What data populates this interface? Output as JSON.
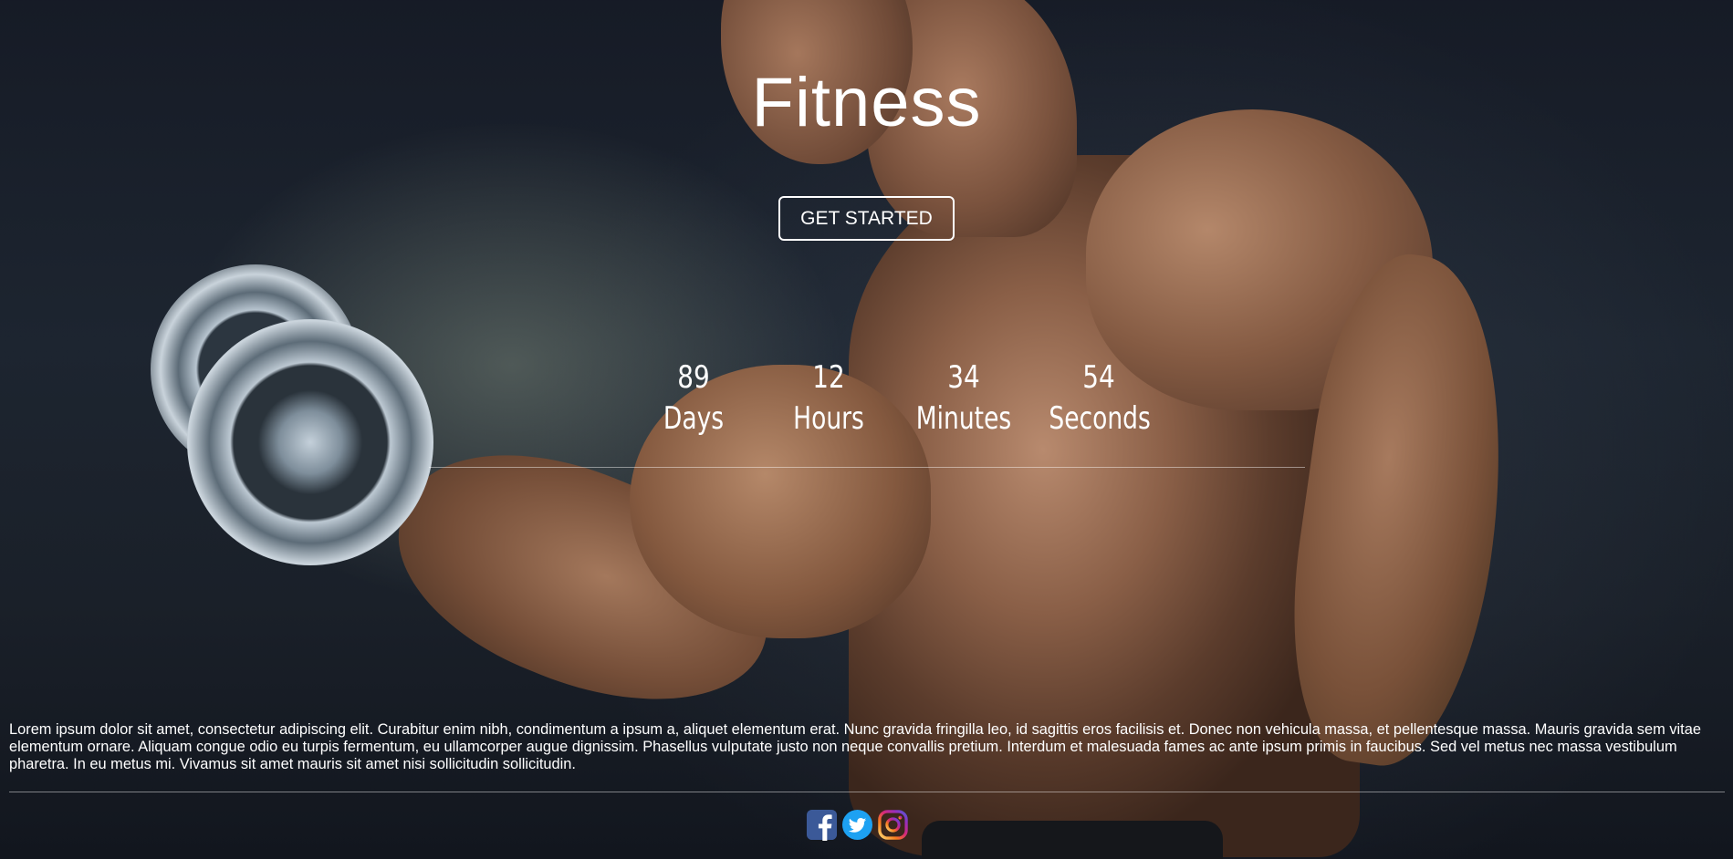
{
  "hero": {
    "title": "Fitness",
    "cta_label": "GET STARTED"
  },
  "countdown": {
    "days": {
      "value": "89",
      "label": "Days"
    },
    "hours": {
      "value": "12",
      "label": "Hours"
    },
    "minutes": {
      "value": "34",
      "label": "Minutes"
    },
    "seconds": {
      "value": "54",
      "label": "Seconds"
    }
  },
  "about": {
    "text": "Lorem ipsum dolor sit amet, consectetur adipiscing elit. Curabitur enim nibh, condimentum a ipsum a, aliquet elementum erat. Nunc gravida fringilla leo, id sagittis eros facilisis et. Donec non vehicula massa, et pellentesque massa. Mauris gravida sem vitae elementum ornare. Aliquam congue odio eu turpis fermentum, eu ullamcorper augue dignissim. Phasellus vulputate justo non neque convallis pretium. Interdum et malesuada fames ac ante ipsum primis in faucibus. Sed vel metus nec massa vestibulum pharetra. In eu metus mi. Vivamus sit amet mauris sit amet nisi sollicitudin sollicitudin."
  },
  "social": {
    "icons": [
      "facebook-icon",
      "twitter-icon",
      "instagram-icon"
    ]
  },
  "colors": {
    "text": "#ffffff",
    "background": "#1a2029",
    "facebook": "#3b5998",
    "twitter": "#1da1f2",
    "instagram": "#c13584"
  }
}
